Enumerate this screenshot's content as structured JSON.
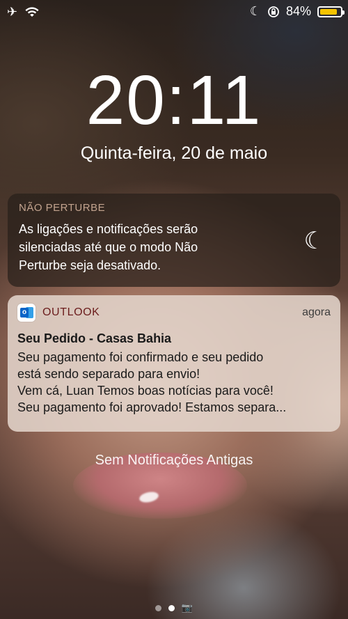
{
  "status_bar": {
    "battery_percent": "84%",
    "battery_level": 0.84,
    "icons": [
      "airplane-icon",
      "wifi-icon",
      "moon-icon",
      "rotation-lock-icon",
      "battery-icon"
    ]
  },
  "lock": {
    "time": "20:11",
    "date": "Quinta-feira, 20 de maio"
  },
  "dnd": {
    "title": "NÃO PERTURBE",
    "message": "As ligações e notificações serão silenciadas até que o modo Não Perturbe seja desativado."
  },
  "notification": {
    "app": "OUTLOOK",
    "time": "agora",
    "title": "Seu Pedido - Casas Bahia",
    "lines": [
      "Seu pagamento foi confirmado e seu pedido",
      "está sendo separado para envio!",
      "Vem cá, Luan Temos boas notícias para você!",
      "Seu pagamento foi aprovado! Estamos separa..."
    ]
  },
  "footer": {
    "no_older": "Sem Notificações Antigas"
  },
  "colors": {
    "battery": "#f5c400",
    "outlook_blue": "#0a64c7"
  }
}
